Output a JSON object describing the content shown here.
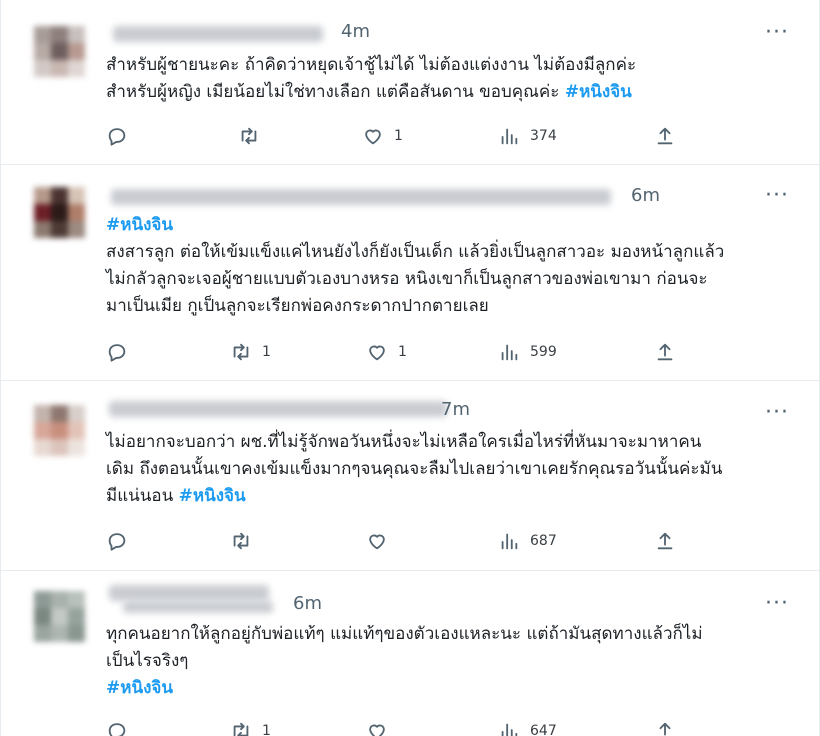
{
  "tweets": [
    {
      "time": "4m",
      "body_lines": [
        "สำหรับผู้ชายนะคะ ถ้าคิดว่าหยุดเจ้าชู้ไม่ได้ ไม่ต้องแต่งงาน  ไม่ต้องมีลูกค่ะ",
        "สำหรับผู้หญิง เมียน้อยไม่ใช่ทางเลือก แต่คือสันดาน ขอบคุณค่ะ "
      ],
      "hashtag": "#หนิงจิน",
      "replies": "",
      "retweets": "",
      "likes": "1",
      "views": "374"
    },
    {
      "time": "6m",
      "hashtag": "#หนิงจิน",
      "body_lines": [
        "สงสารลูก ต่อให้เข้มแข็งแค่ไหนยังไงก็ยังเป็นเด็ก แล้วยิ่งเป็นลูกสาวอะ มองหน้าลูกแล้ว",
        "ไม่กลัวลูกจะเจอผู้ชายแบบตัวเองบางหรอ หนิงเขาก็เป็นลูกสาวของพ่อเขามา ก่อนจะ",
        "มาเป็นเมีย กูเป็นลูกจะเรียกพ่อคงกระดากปากตายเลย"
      ],
      "replies": "",
      "retweets": "1",
      "likes": "1",
      "views": "599"
    },
    {
      "time": "7m",
      "body_lines": [
        "ไม่อยากจะบอกว่า ผช.ที่ไม่รู้จักพอวันหนึ่งจะไม่เหลือใครเมื่อไหร่ที่หันมาจะมาหาคน",
        "เดิม ถึงตอนนั้นเขาคงเข้มแข็งมากๆจนคุณจะลืมไปเลยว่าเขาเคยรักคุณรอวันนั้นค่ะมัน",
        "มีแน่นอน "
      ],
      "hashtag": "#หนิงจิน",
      "replies": "",
      "retweets": "",
      "likes": "",
      "views": "687"
    },
    {
      "time": "6m",
      "body_lines": [
        "ทุกคนอยากให้ลูกอยู่กับพ่อแท้ๆ แม่แท้ๆของตัวเองแหละนะ แต่ถ้ามันสุดทางแล้วก็ไม่",
        "เป็นไรจริงๆ"
      ],
      "hashtag": "#หนิงจิน",
      "replies": "",
      "retweets": "1",
      "likes": "",
      "views": "647"
    }
  ],
  "more_label": "···",
  "colors": {
    "hashtag": "#1d9bf0",
    "secondary": "#536471",
    "border": "#e6ecf0"
  },
  "icons": [
    "reply-icon",
    "retweet-icon",
    "like-icon",
    "views-icon",
    "share-icon",
    "more-icon"
  ]
}
